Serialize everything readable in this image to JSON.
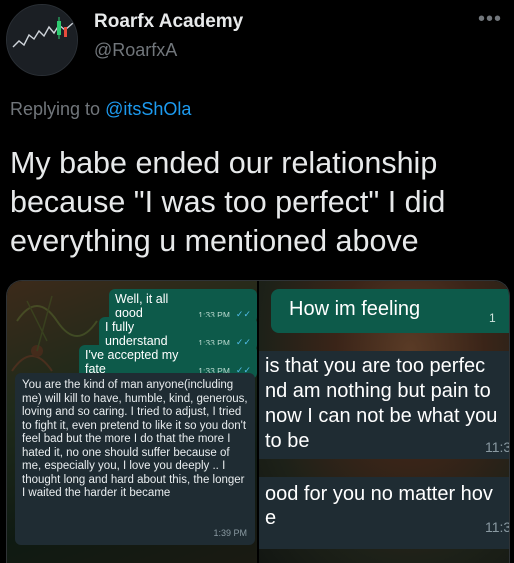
{
  "author": {
    "name": "Roarfx Academy",
    "handle": "@RoarfxA",
    "more_icon": "more-horizontal-icon"
  },
  "reply": {
    "prefix": "Replying to",
    "mention": "@itsShOla"
  },
  "tweet": {
    "text": "My babe ended our relationship because \"I was too perfect\" I did everything u mentioned above"
  },
  "left_chat": {
    "outgoing": [
      {
        "text": "Well, it all good",
        "time": "1:33 PM"
      },
      {
        "text": "I fully understand",
        "time": "1:33 PM"
      },
      {
        "text": "I've accepted my fate",
        "time": "1:33 PM"
      }
    ],
    "incoming": {
      "text": "You are the kind of man anyone(including me) will kill to have, humble, kind, generous, loving and so caring. I tried to adjust, I tried to fight it, even pretend to like it so you don't feel bad but the more I do that the more I hated it, no one should suffer because of me, especially you, I love you deeply .. I thought long and hard about this, the longer I waited the harder it became",
      "time": "1:39 PM"
    }
  },
  "right_chat": {
    "outgoing": {
      "text": "How im feeling",
      "time": "1"
    },
    "incoming1": {
      "lines": [
        "is that you are too perfec",
        "nd am nothing but pain to",
        "now I can not be what you",
        "to be"
      ],
      "time": "11:3"
    },
    "incoming2": {
      "lines": [
        "ood for you no matter hov",
        "e"
      ],
      "time": "11:3"
    }
  }
}
